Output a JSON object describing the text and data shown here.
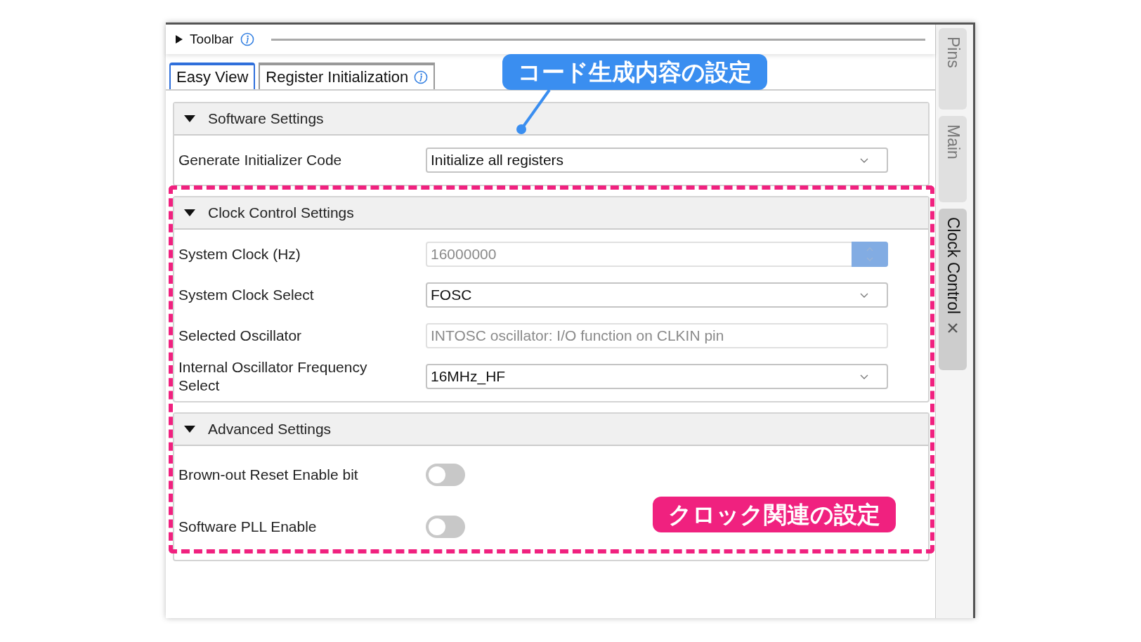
{
  "toolbar": {
    "label": "Toolbar",
    "expanded": false
  },
  "tabs": [
    {
      "label": "Easy View",
      "selected": true,
      "info": false
    },
    {
      "label": "Register Initialization",
      "selected": false,
      "info": true
    }
  ],
  "sections": [
    {
      "title": "Software Settings",
      "expanded": true,
      "rows": [
        {
          "kind": "select",
          "label": "Generate Initializer Code",
          "value": "Initialize all registers",
          "disabled": false
        }
      ]
    },
    {
      "title": "Clock Control Settings",
      "expanded": true,
      "rows": [
        {
          "kind": "spinner",
          "label": "System Clock (Hz)",
          "value": "16000000",
          "disabled": true
        },
        {
          "kind": "select",
          "label": "System Clock Select",
          "value": "FOSC",
          "disabled": false
        },
        {
          "kind": "text",
          "label": "Selected Oscillator",
          "value": "INTOSC oscillator: I/O function on CLKIN pin",
          "disabled": true
        },
        {
          "kind": "select",
          "label": "Internal Oscillator Frequency Select",
          "value": "16MHz_HF",
          "disabled": false
        }
      ]
    },
    {
      "title": "Advanced Settings",
      "expanded": true,
      "rows": [
        {
          "kind": "toggle",
          "label": "Brown-out Reset Enable bit",
          "on": false
        },
        {
          "kind": "toggle",
          "label": "Software PLL Enable",
          "on": false
        }
      ]
    }
  ],
  "side_tabs": [
    {
      "label": "Pins",
      "selected": false,
      "closable": false
    },
    {
      "label": "Main",
      "selected": false,
      "closable": false
    },
    {
      "label": "Clock Control",
      "selected": true,
      "closable": true
    }
  ],
  "annotations": [
    {
      "text": "コード生成内容の設定",
      "color": "#3a8ef0"
    },
    {
      "text": "クロック関連の設定",
      "color": "#f0217f"
    }
  ]
}
